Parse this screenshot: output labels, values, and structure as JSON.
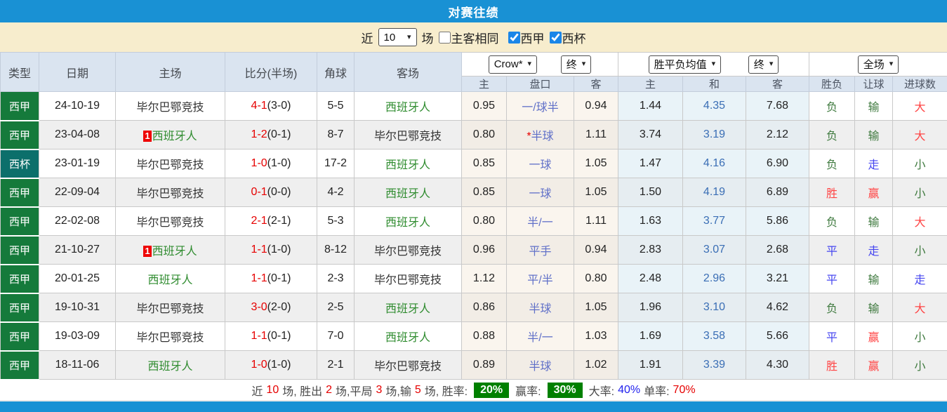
{
  "title": "对赛往绩",
  "filter": {
    "near_label": "近",
    "matches_count": "10",
    "matches_label": "场",
    "same_side_label": "主客相同",
    "league1_label": "西甲",
    "league2_label": "西杯",
    "same_side_checked": false,
    "league1_checked": true,
    "league2_checked": true
  },
  "table": {
    "headers": {
      "type": "类型",
      "date": "日期",
      "home": "主场",
      "score": "比分(半场)",
      "corners": "角球",
      "away": "客场"
    },
    "selects": {
      "bookmaker": "Crow*",
      "final1": "终",
      "avg": "胜平负均值",
      "final2": "终",
      "scope": "全场"
    },
    "subheaders": {
      "crow_home": "主",
      "handicap": "盘口",
      "crow_away": "客",
      "avg_home": "主",
      "avg_draw": "和",
      "avg_away": "客",
      "outcome": "胜负",
      "let_result": "让球",
      "goals": "进球数"
    }
  },
  "rows": [
    {
      "type": "西甲",
      "type_color": "green",
      "date": "24-10-19",
      "badge": "",
      "home": "毕尔巴鄂竞技",
      "score": "4-1",
      "half": "(3-0)",
      "corners": "5-5",
      "away": "西班牙人",
      "away_color": "green",
      "crow_home": "0.95",
      "star": "",
      "handicap": "一/球半",
      "crow_away": "0.94",
      "avg_home": "1.44",
      "avg_draw": "4.35",
      "avg_away": "7.68",
      "outcome": "负",
      "outcome_color": "dgreen",
      "let": "输",
      "let_color": "dgreen",
      "goals": "大",
      "goals_color": "red"
    },
    {
      "type": "西甲",
      "type_color": "green",
      "date": "23-04-08",
      "badge": "1",
      "home": "西班牙人",
      "home_color": "green",
      "score": "1-2",
      "half": "(0-1)",
      "corners": "8-7",
      "away": "毕尔巴鄂竞技",
      "crow_home": "0.80",
      "star": "*",
      "handicap": "半球",
      "crow_away": "1.11",
      "avg_home": "3.74",
      "avg_draw": "3.19",
      "avg_away": "2.12",
      "outcome": "负",
      "outcome_color": "dgreen",
      "let": "输",
      "let_color": "dgreen",
      "goals": "大",
      "goals_color": "red"
    },
    {
      "type": "西杯",
      "type_color": "teal",
      "date": "23-01-19",
      "badge": "",
      "home": "毕尔巴鄂竞技",
      "score": "1-0",
      "half": "(1-0)",
      "corners": "17-2",
      "away": "西班牙人",
      "away_color": "green",
      "crow_home": "0.85",
      "star": "",
      "handicap": "一球",
      "crow_away": "1.05",
      "avg_home": "1.47",
      "avg_draw": "4.16",
      "avg_away": "6.90",
      "outcome": "负",
      "outcome_color": "dgreen",
      "let": "走",
      "let_color": "blue",
      "goals": "小",
      "goals_color": "dgreen"
    },
    {
      "type": "西甲",
      "type_color": "green",
      "date": "22-09-04",
      "badge": "",
      "home": "毕尔巴鄂竞技",
      "score": "0-1",
      "half": "(0-0)",
      "corners": "4-2",
      "away": "西班牙人",
      "away_color": "green",
      "crow_home": "0.85",
      "star": "",
      "handicap": "一球",
      "crow_away": "1.05",
      "avg_home": "1.50",
      "avg_draw": "4.19",
      "avg_away": "6.89",
      "outcome": "胜",
      "outcome_color": "red",
      "let": "赢",
      "let_color": "red",
      "goals": "小",
      "goals_color": "dgreen"
    },
    {
      "type": "西甲",
      "type_color": "green",
      "date": "22-02-08",
      "badge": "",
      "home": "毕尔巴鄂竞技",
      "score": "2-1",
      "half": "(2-1)",
      "corners": "5-3",
      "away": "西班牙人",
      "away_color": "green",
      "crow_home": "0.80",
      "star": "",
      "handicap": "半/一",
      "crow_away": "1.11",
      "avg_home": "1.63",
      "avg_draw": "3.77",
      "avg_away": "5.86",
      "outcome": "负",
      "outcome_color": "dgreen",
      "let": "输",
      "let_color": "dgreen",
      "goals": "大",
      "goals_color": "red"
    },
    {
      "type": "西甲",
      "type_color": "green",
      "date": "21-10-27",
      "badge": "1",
      "home": "西班牙人",
      "home_color": "green",
      "score": "1-1",
      "half": "(1-0)",
      "corners": "8-12",
      "away": "毕尔巴鄂竞技",
      "crow_home": "0.96",
      "star": "",
      "handicap": "平手",
      "crow_away": "0.94",
      "avg_home": "2.83",
      "avg_draw": "3.07",
      "avg_away": "2.68",
      "outcome": "平",
      "outcome_color": "blue",
      "let": "走",
      "let_color": "blue",
      "goals": "小",
      "goals_color": "dgreen"
    },
    {
      "type": "西甲",
      "type_color": "green",
      "date": "20-01-25",
      "badge": "",
      "home": "西班牙人",
      "home_color": "green",
      "score": "1-1",
      "half": "(0-1)",
      "corners": "2-3",
      "away": "毕尔巴鄂竞技",
      "crow_home": "1.12",
      "star": "",
      "handicap": "平/半",
      "crow_away": "0.80",
      "avg_home": "2.48",
      "avg_draw": "2.96",
      "avg_away": "3.21",
      "outcome": "平",
      "outcome_color": "blue",
      "let": "输",
      "let_color": "dgreen",
      "goals": "走",
      "goals_color": "blue"
    },
    {
      "type": "西甲",
      "type_color": "green",
      "date": "19-10-31",
      "badge": "",
      "home": "毕尔巴鄂竞技",
      "score": "3-0",
      "half": "(2-0)",
      "corners": "2-5",
      "away": "西班牙人",
      "away_color": "green",
      "crow_home": "0.86",
      "star": "",
      "handicap": "半球",
      "crow_away": "1.05",
      "avg_home": "1.96",
      "avg_draw": "3.10",
      "avg_away": "4.62",
      "outcome": "负",
      "outcome_color": "dgreen",
      "let": "输",
      "let_color": "dgreen",
      "goals": "大",
      "goals_color": "red"
    },
    {
      "type": "西甲",
      "type_color": "green",
      "date": "19-03-09",
      "badge": "",
      "home": "毕尔巴鄂竞技",
      "score": "1-1",
      "half": "(0-1)",
      "corners": "7-0",
      "away": "西班牙人",
      "away_color": "green",
      "crow_home": "0.88",
      "star": "",
      "handicap": "半/一",
      "crow_away": "1.03",
      "avg_home": "1.69",
      "avg_draw": "3.58",
      "avg_away": "5.66",
      "outcome": "平",
      "outcome_color": "blue",
      "let": "赢",
      "let_color": "red",
      "goals": "小",
      "goals_color": "dgreen"
    },
    {
      "type": "西甲",
      "type_color": "green",
      "date": "18-11-06",
      "badge": "",
      "home": "西班牙人",
      "home_color": "green",
      "score": "1-0",
      "half": "(1-0)",
      "corners": "2-1",
      "away": "毕尔巴鄂竞技",
      "crow_home": "0.89",
      "star": "",
      "handicap": "半球",
      "crow_away": "1.02",
      "avg_home": "1.91",
      "avg_draw": "3.39",
      "avg_away": "4.30",
      "outcome": "胜",
      "outcome_color": "red",
      "let": "赢",
      "let_color": "red",
      "goals": "小",
      "goals_color": "dgreen"
    }
  ],
  "summary": {
    "p1": "近",
    "n_total": "10",
    "p2": "场, 胜出",
    "n_wins": "2",
    "p3": "场,平局",
    "n_draws": "3",
    "p4": "场,输",
    "n_losses": "5",
    "p5": "场, 胜率:",
    "win_rate": "20%",
    "p6": "赢率:",
    "profit_rate": "30%",
    "p7": "大率:",
    "big_rate": "40%",
    "p8": "单率:",
    "single_rate": "70%"
  },
  "colors": {
    "title_bar": "#1991d4",
    "filter_bg": "#f7edcd",
    "league_green": "#157a3b",
    "cup_teal": "#0c6f6b",
    "win_red": "#ff4444",
    "lose_green": "#3f7a3f",
    "go_blue": "#4646f0",
    "score_red": "#e60000",
    "handicap_blue": "#6070c8",
    "rate_badge_green": "#008000"
  }
}
